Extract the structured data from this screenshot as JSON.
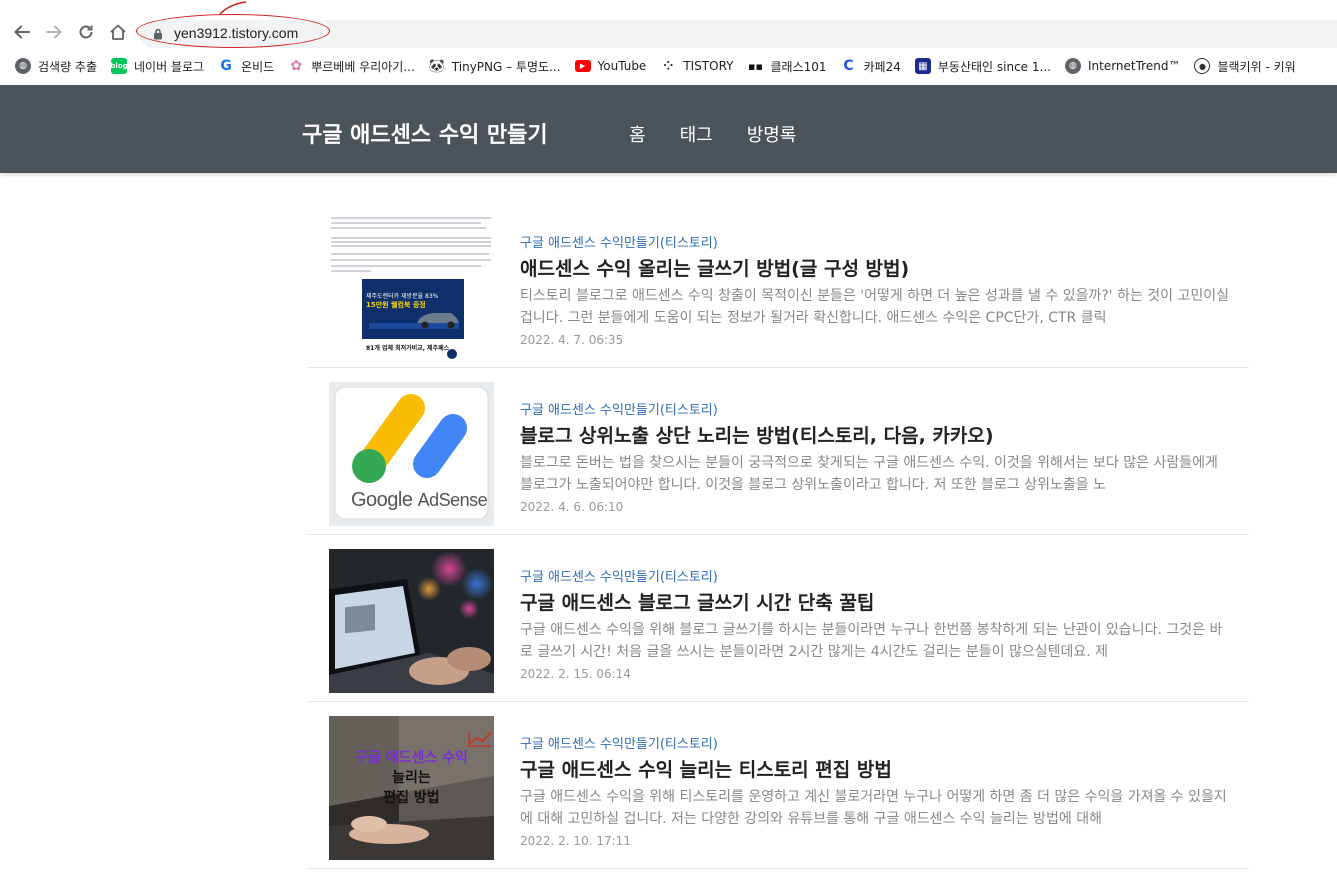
{
  "browser": {
    "url": "yen3912.tistory.com",
    "bookmarks": [
      {
        "label": "검색량 추출",
        "icon": "globe-icon"
      },
      {
        "label": "네이버 블로그",
        "icon": "naver-blog-icon"
      },
      {
        "label": "온비드",
        "icon": "onbid-icon"
      },
      {
        "label": "뿌르베베 우리아기...",
        "icon": "flower-icon"
      },
      {
        "label": "TinyPNG – 투명도...",
        "icon": "panda-icon"
      },
      {
        "label": "YouTube",
        "icon": "youtube-icon"
      },
      {
        "label": "TISTORY",
        "icon": "tistory-icon"
      },
      {
        "label": "클래스101",
        "icon": "class101-icon"
      },
      {
        "label": "카페24",
        "icon": "cafe24-icon"
      },
      {
        "label": "부동산태인 since 1...",
        "icon": "grid-icon"
      },
      {
        "label": "InternetTrend™",
        "icon": "globe-icon"
      },
      {
        "label": "블랙키위 - 키워",
        "icon": "blackkiwi-icon"
      }
    ]
  },
  "site": {
    "title": "구글 애드센스 수익 만들기",
    "menu": [
      "홈",
      "태그",
      "방명록"
    ]
  },
  "posts": [
    {
      "category": "구글 애드센스 수익만들기(티스토리)",
      "title": "애드센스 수익 올리는 글쓰기 방법(글 구성 방법)",
      "excerpt": "티스토리 블로그로 애드센스 수익 창출이 목적이신 분들은 '어떻게 하면 더 높은 성과를 낼 수 있을까?' 하는 것이 고민이실겁니다. 그런 분들에게 도움이 되는 정보가 될거라 확신합니다. 애드센스 수익은 CPC단가, CTR 클릭",
      "date": "2022. 4. 7. 06:35",
      "thumb_ad_line1": "제주도렌터카 재방문율 83%",
      "thumb_ad_line2": "15만원 웰컴북 증정",
      "thumb_ad_line3": "81개 업체 최저가비교, 제주패스"
    },
    {
      "category": "구글 애드센스 수익만들기(티스토리)",
      "title": "블로그 상위노출 상단 노리는 방법(티스토리, 다음, 카카오)",
      "excerpt": "블로그로 돈버는 법을 찾으시는 분들이 궁극적으로 찾게되는 구글 애드센스 수익. 이것을 위해서는 보다 많은 사람들에게 블로그가 노출되어야만 합니다. 이것을 블로그 상위노출이라고 합니다. 저 또한 블로그 상위노출을 노",
      "date": "2022. 4. 6. 06:10",
      "thumb_text_google": "Google",
      "thumb_text_adsense": "AdSense"
    },
    {
      "category": "구글 애드센스 수익만들기(티스토리)",
      "title": "구글 애드센스 블로그 글쓰기 시간 단축 꿀팁",
      "excerpt": "구글 애드센스 수익을 위해 블로그 글쓰기를 하시는 분들이라면 누구나 한번쯤 봉착하게 되는 난관이 있습니다. 그것은 바로 글쓰기 시간! 처음 글을 쓰시는 분들이라면 2시간 많게는 4시간도 걸리는 분들이 많으실텐데요. 제",
      "date": "2022. 2. 15. 06:14"
    },
    {
      "category": "구글 애드센스 수익만들기(티스토리)",
      "title": "구글 애드센스 수익 늘리는 티스토리 편집 방법",
      "excerpt": "구글 애드센스 수익을 위해 티스토리를 운영하고 계신 블로거라면 누구나 어떻게 하면 좀 더 많은 수익을 가져올 수 있을지에 대해 고민하실 겁니다. 저는 다양한 강의와 유튜브를 통해 구글 애드센스 수익 늘리는 방법에 대해",
      "date": "2022. 2. 10. 17:11",
      "thumb_line1": "구글 애드센스 수익",
      "thumb_line2": "늘리는",
      "thumb_line3": "편집 방법"
    }
  ],
  "colors": {
    "header_bg": "#4b535b",
    "category": "#2f6db5",
    "annotation": "#d21f1f"
  }
}
